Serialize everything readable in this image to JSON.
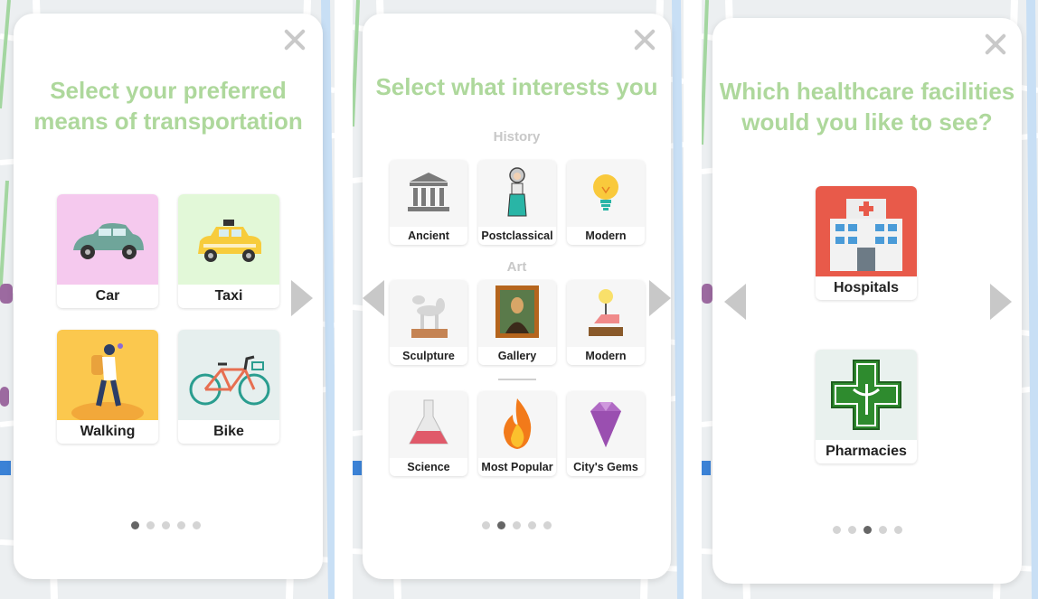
{
  "colors": {
    "title_green": "#aed89c",
    "arrow_gray": "#c8c8c8",
    "dot_active": "#666666",
    "dot_inactive": "#d4d4d4"
  },
  "panels": [
    {
      "title_line1": "Select your preferred",
      "title_line2": "means of transportation",
      "options": [
        {
          "label": "Car",
          "icon": "car-icon"
        },
        {
          "label": "Taxi",
          "icon": "taxi-icon"
        },
        {
          "label": "Walking",
          "icon": "walking-person-icon"
        },
        {
          "label": "Bike",
          "icon": "bicycle-icon"
        }
      ],
      "page_dots": 5,
      "active_dot": 1
    },
    {
      "title": "Select what interests you",
      "sections": [
        {
          "heading": "History",
          "items": [
            {
              "label": "Ancient",
              "icon": "temple-icon"
            },
            {
              "label": "Postclassical",
              "icon": "medieval-figure-icon"
            },
            {
              "label": "Modern",
              "icon": "light-bulb-icon"
            }
          ]
        },
        {
          "heading": "Art",
          "items": [
            {
              "label": "Sculpture",
              "icon": "balloon-dog-icon"
            },
            {
              "label": "Gallery",
              "icon": "mona-lisa-icon"
            },
            {
              "label": "Modern",
              "icon": "lamp-sculpture-icon"
            }
          ]
        },
        {
          "heading": "",
          "items": [
            {
              "label": "Science",
              "icon": "flask-icon"
            },
            {
              "label": "Most Popular",
              "icon": "fire-icon"
            },
            {
              "label": "City's Gems",
              "icon": "gem-icon"
            }
          ]
        }
      ],
      "page_dots": 5,
      "active_dot": 2
    },
    {
      "title_line1": "Which healthcare facilities",
      "title_line2": "would you like to see?",
      "options": [
        {
          "label": "Hospitals",
          "icon": "hospital-icon"
        },
        {
          "label": "Pharmacies",
          "icon": "pharmacy-cross-icon"
        }
      ],
      "page_dots": 5,
      "active_dot": 3
    }
  ]
}
